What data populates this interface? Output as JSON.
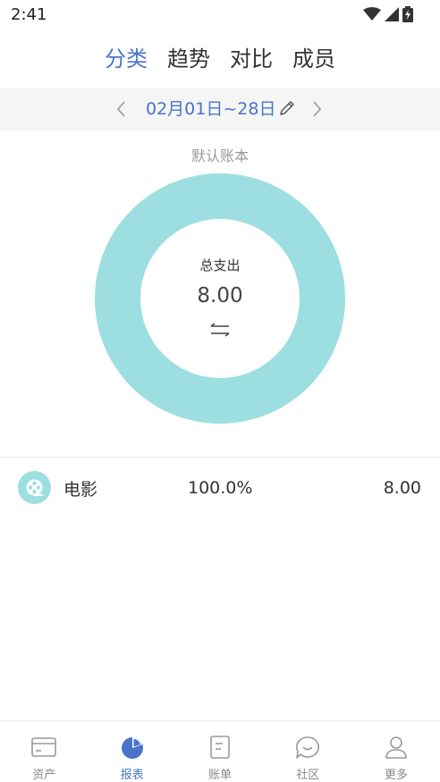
{
  "status_bar": {
    "time": "2:41"
  },
  "top_tabs": [
    {
      "label": "分类",
      "active": true
    },
    {
      "label": "趋势",
      "active": false
    },
    {
      "label": "对比",
      "active": false
    },
    {
      "label": "成员",
      "active": false
    }
  ],
  "date_bar": {
    "range": "02月01日~28日"
  },
  "book_name": "默认账本",
  "chart_data": {
    "type": "pie",
    "center_label": "总支出",
    "center_value": "8.00",
    "slices": [
      {
        "name": "电影",
        "value": 8.0,
        "percent": 100.0,
        "color": "#9ddfe1"
      }
    ]
  },
  "categories": [
    {
      "name": "电影",
      "percent": "100.0%",
      "amount": "8.00",
      "icon": "film-reel-icon"
    }
  ],
  "bottom_nav": [
    {
      "label": "资产",
      "icon": "card-icon",
      "active": false
    },
    {
      "label": "报表",
      "icon": "pie-chart-icon",
      "active": true
    },
    {
      "label": "账单",
      "icon": "bill-icon",
      "active": false
    },
    {
      "label": "社区",
      "icon": "chat-icon",
      "active": false
    },
    {
      "label": "更多",
      "icon": "user-icon",
      "active": false
    }
  ],
  "colors": {
    "accent": "#4a74c9",
    "donut": "#9ddfe1",
    "date_bar_bg": "#f5f5f5"
  }
}
